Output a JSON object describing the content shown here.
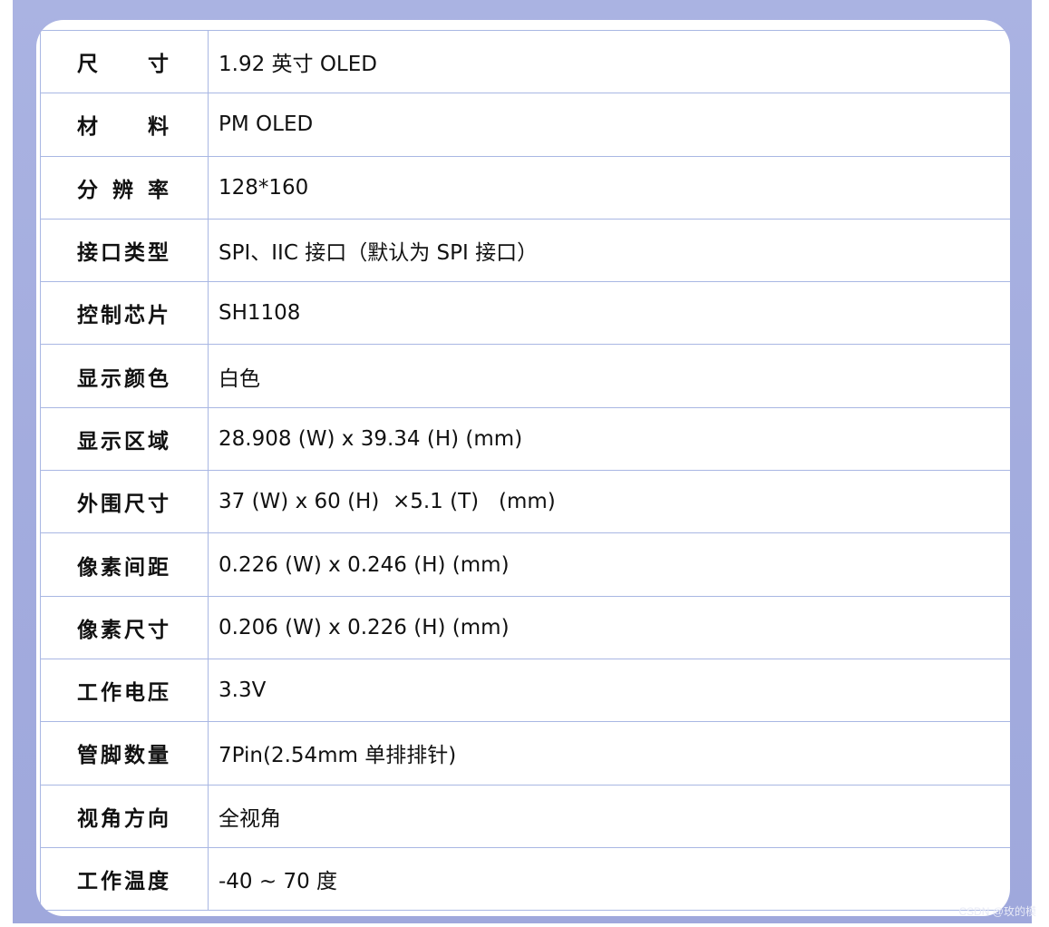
{
  "specs": [
    {
      "label": "尺 寸",
      "value": "1.92 英寸 OLED"
    },
    {
      "label": "材 料",
      "value": "PM OLED"
    },
    {
      "label": "分辨率",
      "value": "128*160"
    },
    {
      "label": "接口类型",
      "value": "SPI、IIC 接口（默认为 SPI 接口）"
    },
    {
      "label": "控制芯片",
      "value": "SH1108"
    },
    {
      "label": "显示颜色",
      "value": "白色"
    },
    {
      "label": "显示区域",
      "value": "28.908 (W) x 39.34 (H) (mm)"
    },
    {
      "label": "外围尺寸",
      "value": "37 (W) x 60 (H)  ×5.1 (T)   (mm)"
    },
    {
      "label": "像素间距",
      "value": "0.226 (W) x 0.246 (H) (mm)"
    },
    {
      "label": "像素尺寸",
      "value": "0.206 (W) x 0.226 (H) (mm)"
    },
    {
      "label": "工作电压",
      "value": "3.3V"
    },
    {
      "label": "管脚数量",
      "value": "7Pin(2.54mm 单排排针)"
    },
    {
      "label": "视角方向",
      "value": "全视角"
    },
    {
      "label": "工作温度",
      "value": "-40 ~ 70 度"
    }
  ],
  "watermark": "CSDN @玫的模",
  "colors": {
    "frame_background": "#a3acde",
    "grid_line": "#a9b7e3",
    "card_background": "#ffffff",
    "text": "#111111"
  }
}
